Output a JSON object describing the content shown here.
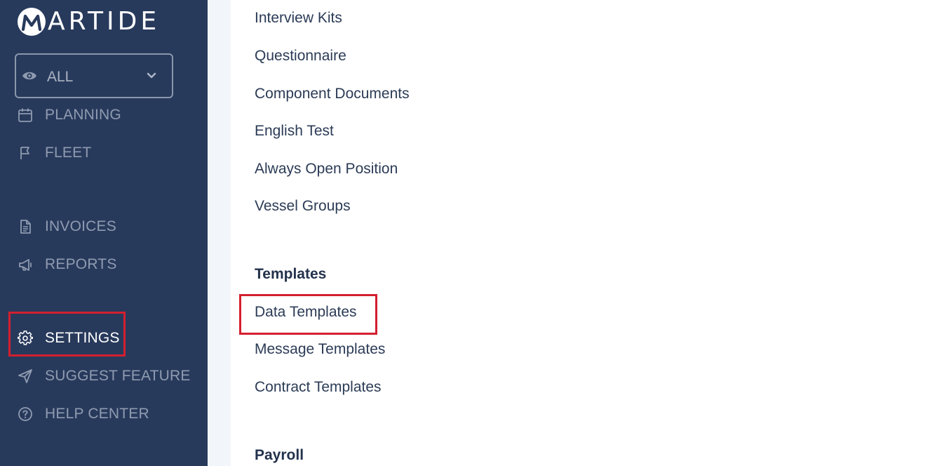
{
  "brand": {
    "name": "ARTIDE"
  },
  "filter": {
    "value": "ALL"
  },
  "sidebar": {
    "items": [
      {
        "label": "PLANNING"
      },
      {
        "label": "FLEET"
      },
      {
        "label": "INVOICES"
      },
      {
        "label": "REPORTS"
      },
      {
        "label": "SETTINGS"
      },
      {
        "label": "SUGGEST FEATURE"
      },
      {
        "label": "HELP CENTER"
      }
    ]
  },
  "main": {
    "links_top": [
      "Interview Kits",
      "Questionnaire",
      "Component Documents",
      "English Test",
      "Always Open Position",
      "Vessel Groups"
    ],
    "templates": {
      "heading": "Templates",
      "links": [
        "Data Templates",
        "Message Templates",
        "Contract Templates"
      ]
    },
    "payroll": {
      "heading": "Payroll"
    }
  },
  "colors": {
    "sidebar_bg": "#283a5c",
    "nav_inactive": "#8f9bb0",
    "nav_active": "#ffffff",
    "highlight": "#d41f2f",
    "link_text": "#2b3b56"
  }
}
